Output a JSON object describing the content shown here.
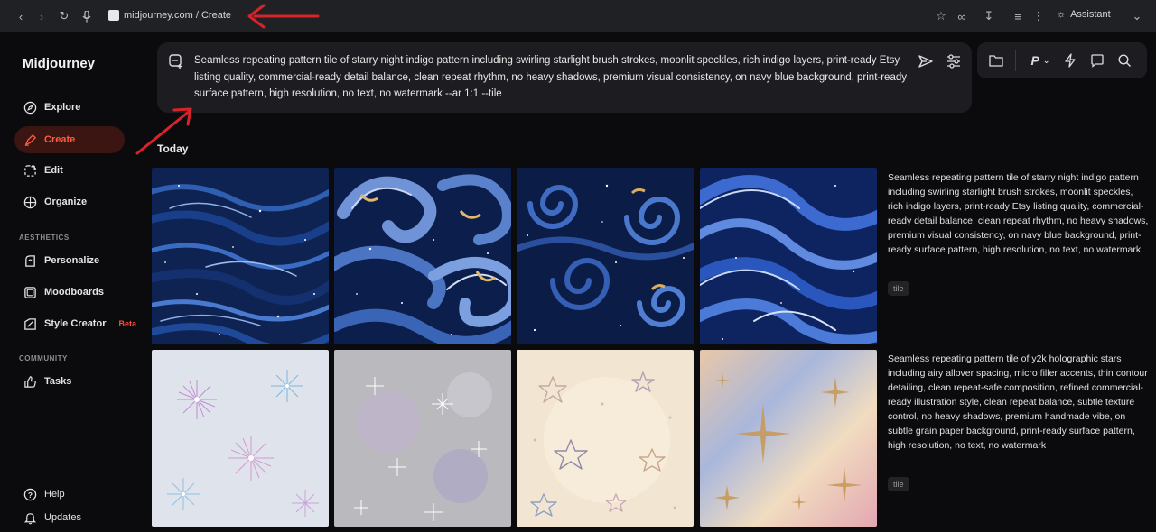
{
  "browser": {
    "url": "midjourney.com / Create",
    "assistant_label": "Assistant"
  },
  "sidebar": {
    "brand": "Midjourney",
    "items": [
      {
        "label": "Explore",
        "icon": "compass-icon"
      },
      {
        "label": "Create",
        "icon": "brush-icon",
        "active": true
      },
      {
        "label": "Edit",
        "icon": "edit-icon"
      },
      {
        "label": "Organize",
        "icon": "grid-icon"
      }
    ],
    "aesthetics_label": "AESTHETICS",
    "aesthetics_items": [
      {
        "label": "Personalize",
        "icon": "personalize-icon"
      },
      {
        "label": "Moodboards",
        "icon": "moodboard-icon"
      },
      {
        "label": "Style Creator",
        "icon": "style-creator-icon",
        "badge": "Beta"
      }
    ],
    "community_label": "COMMUNITY",
    "community_items": [
      {
        "label": "Tasks",
        "icon": "thumbs-up-icon"
      }
    ],
    "footer_items": [
      {
        "label": "Help",
        "icon": "help-icon"
      },
      {
        "label": "Updates",
        "icon": "bell-icon"
      }
    ]
  },
  "prompt": {
    "text": "Seamless repeating pattern tile of starry night indigo pattern including swirling starlight brush strokes, moonlit speckles, rich indigo layers, print-ready Etsy listing quality, commercial-ready detail balance, clean repeat rhythm, no heavy shadows, premium visual consistency, on navy blue background, print-ready surface pattern, high resolution, no text, no watermark --ar 1:1 --tile"
  },
  "toolbar": {
    "profile_letter": "P"
  },
  "feed": {
    "section_title": "Today",
    "generations": [
      {
        "caption": "Seamless repeating pattern tile of starry night indigo pattern including swirling starlight brush strokes, moonlit speckles, rich indigo layers, print-ready Etsy listing quality, commercial-ready detail balance, clean repeat rhythm, no heavy shadows, premium visual consistency, on navy blue background, print-ready surface pattern, high resolution, no text, no watermark",
        "tag": "tile"
      },
      {
        "caption": "Seamless repeating pattern tile of y2k holographic stars including airy allover spacing, micro filler accents, thin contour detailing, clean repeat-safe composition, refined commercial-ready illustration style, clean repeat balance, subtle texture control, no heavy shadows, premium handmade vibe, on subtle grain paper background, print-ready surface pattern, high resolution, no text, no watermark",
        "tag": "tile"
      }
    ]
  },
  "colors": {
    "active_nav": "#ff5a43",
    "annotation_arrow": "#d8232a",
    "background": "#0b0b0d",
    "panel": "#1d1d21"
  }
}
